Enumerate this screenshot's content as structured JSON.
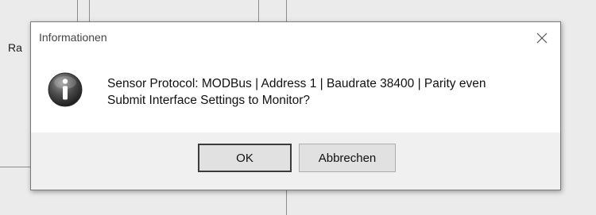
{
  "background": {
    "partial_label": "Ra"
  },
  "dialog": {
    "title": "Informationen",
    "close_icon": "close-icon",
    "icon": "info-icon",
    "message_line1": "Sensor Protocol: MODBus | Address 1 | Baudrate 38400 | Parity even",
    "message_line2": "Submit Interface Settings to Monitor?",
    "ok_label": "OK",
    "cancel_label": "Abbrechen"
  }
}
